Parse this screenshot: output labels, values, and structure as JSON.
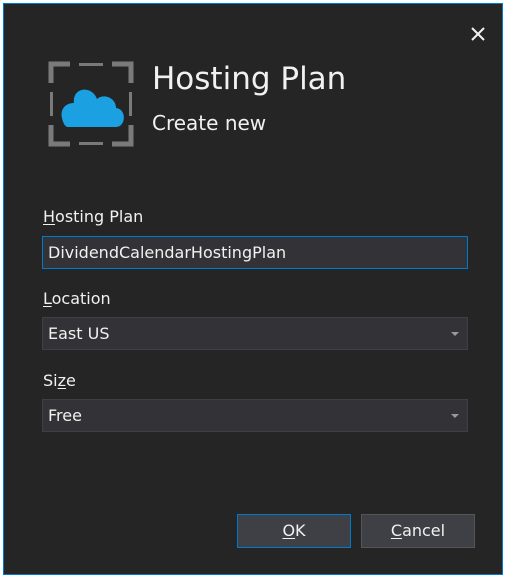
{
  "dialog": {
    "title": "Hosting Plan",
    "subtitle": "Create new",
    "logo_icon": "cloud-frame-icon",
    "close_icon": "close-icon"
  },
  "fields": {
    "hosting_plan": {
      "label_access_key": "H",
      "label_rest": "osting Plan",
      "value": "DividendCalendarHostingPlan"
    },
    "location": {
      "label_access_key": "L",
      "label_rest": "ocation",
      "value": "East US"
    },
    "size": {
      "label_pre": "Si",
      "label_access_key": "z",
      "label_rest": "e",
      "value": "Free"
    }
  },
  "buttons": {
    "ok": {
      "access_key": "O",
      "rest": "K"
    },
    "cancel": {
      "access_key": "C",
      "rest": "ancel"
    }
  },
  "colors": {
    "background": "#252526",
    "accent": "#007acc",
    "text": "#f1f1f1",
    "input_bg": "#333337",
    "cloud": "#1ba1e2",
    "frame": "#7a7a7a"
  }
}
